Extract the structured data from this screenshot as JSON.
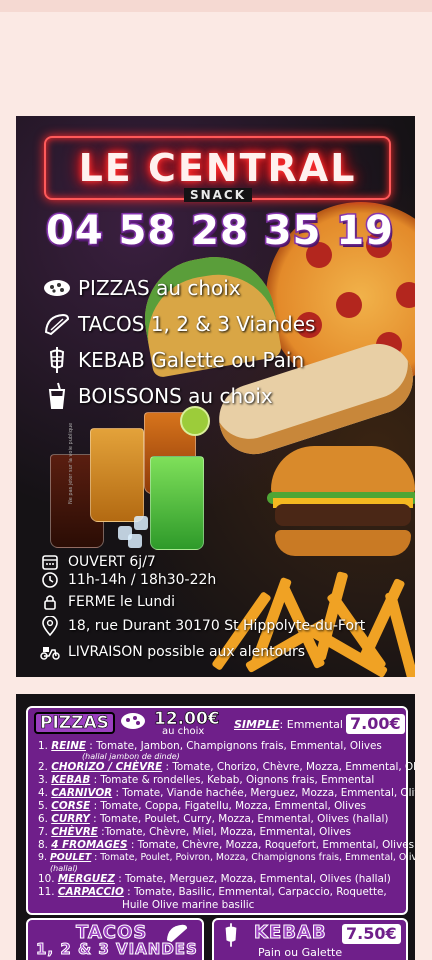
{
  "flyer": {
    "title": "LE CENTRAL",
    "subtitle": "SNACK",
    "phone": "04 58 28 35 19",
    "features": [
      {
        "icon": "pizza-icon",
        "text": "PIZZAS au choix"
      },
      {
        "icon": "taco-icon",
        "text": "TACOS 1, 2 & 3 Viandes"
      },
      {
        "icon": "kebab-icon",
        "text": "KEBAB Galette ou Pain"
      },
      {
        "icon": "drink-icon",
        "text": "BOISSONS au choix"
      }
    ],
    "info": [
      {
        "icon": "calendar-icon",
        "text": "OUVERT 6j/7"
      },
      {
        "icon": "clock-icon",
        "text": "11h-14h / 18h30-22h"
      },
      {
        "icon": "lock-icon",
        "text": "FERME le Lundi"
      },
      {
        "icon": "location-pin-icon",
        "text": "18, rue Durant 30170 St Hippolyte-du-Fort"
      },
      {
        "icon": "scooter-icon",
        "text": "LIVRAISON possible aux alentours"
      }
    ]
  },
  "menu": {
    "pizzas_heading": "PIZZAS",
    "pizzas_price": "12.00€",
    "pizzas_price_sub": "au choix",
    "simple_label": "SIMPLE",
    "simple_desc": ": Emmental",
    "simple_price": "7.00€",
    "items": [
      {
        "num": "1.",
        "name": "REINE",
        "desc": " : Tomate, Jambon, Champignons frais, Emmental, Olives"
      },
      {
        "num": "2.",
        "name": "CHORIZO / CHÈVRE",
        "desc": " : Tomate, Chorizo, Chèvre, Mozza, Emmental, Olives"
      },
      {
        "num": "3.",
        "name": "KEBAB",
        "desc": " : Tomate & rondelles, Kebab, Oignons frais, Emmental"
      },
      {
        "num": "4.",
        "name": "CARNIVOR",
        "desc": " : Tomate, Viande hachée, Merguez, Mozza, Emmental, Olives"
      },
      {
        "num": "5.",
        "name": "CORSE",
        "desc": " : Tomate, Coppa, Figatellu, Mozza, Emmental, Olives"
      },
      {
        "num": "6.",
        "name": "CURRY",
        "desc": " : Tomate, Poulet, Curry, Mozza, Emmental, Olives   (hallal)"
      },
      {
        "num": "7.",
        "name": "CHÈVRE",
        "desc": " :Tomate, Chèvre, Miel, Mozza, Emmental, Olives"
      },
      {
        "num": "8.",
        "name": "4 FROMAGES",
        "desc": " : Tomate, Chèvre, Mozza, Roquefort, Emmental, Olives"
      },
      {
        "num": "9.",
        "name": "POULET",
        "desc": " : Tomate, Poulet, Poivron, Mozza, Champignons frais, Emmental,  Olives"
      },
      {
        "num": "10.",
        "name": "MERGUEZ",
        "desc": " : Tomate, Merguez, Mozza, Emmental, Olives   (hallal)"
      },
      {
        "num": "11.",
        "name": "CARPACCIO",
        "desc": " : Tomate, Basilic, Emmental, Carpaccio, Roquette,"
      }
    ],
    "reine_note": "(hallal jambon de dinde)",
    "poulet_note": "(hallal)",
    "carpaccio_cont": "Huile Olive marine basilic",
    "tacos_heading": "TACOS",
    "tacos_sub": "1, 2 & 3 VIANDES",
    "kebab_heading": "KEBAB",
    "kebab_price": "7.50€",
    "kebab_sub": "Pain ou Galette"
  },
  "colors": {
    "brand_purple": "#6f1f8a",
    "neon_red": "#ff2a2a"
  }
}
